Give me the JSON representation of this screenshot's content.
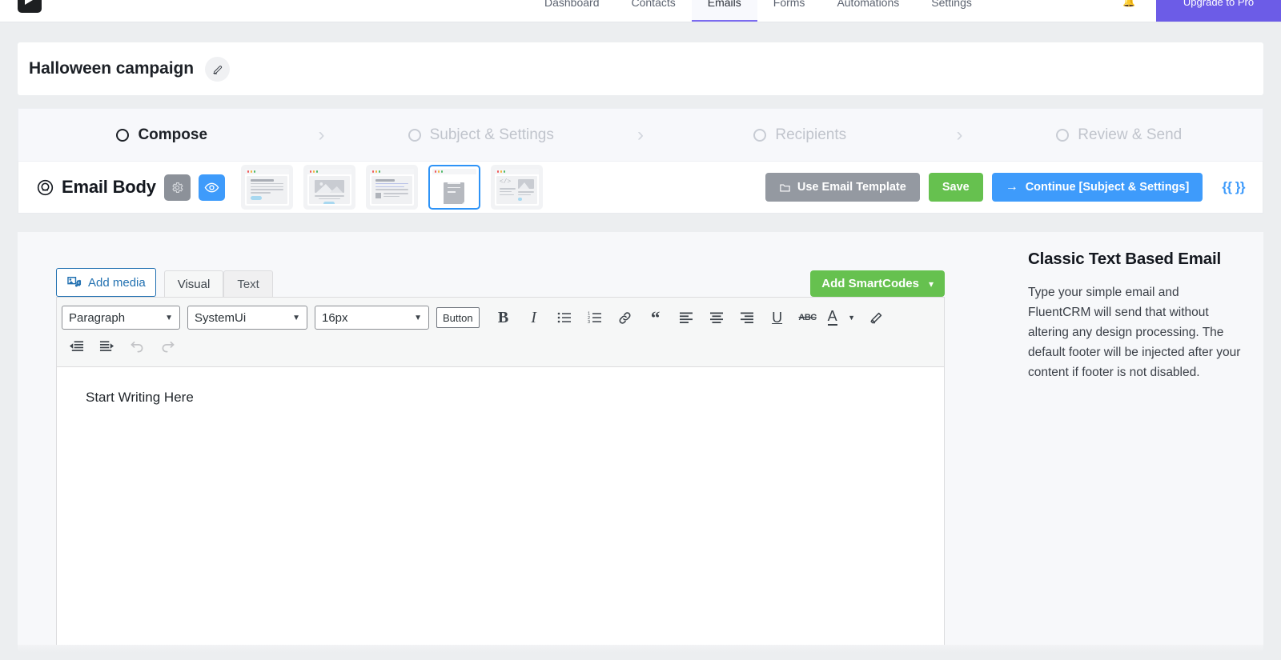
{
  "adminbar": {
    "logo_icon": "play-logo-icon",
    "tabs": [
      {
        "label": "Dashboard",
        "active": false
      },
      {
        "label": "Contacts",
        "active": false
      },
      {
        "label": "Emails",
        "active": true
      },
      {
        "label": "Forms",
        "active": false
      },
      {
        "label": "Automations",
        "active": false
      },
      {
        "label": "Settings",
        "active": false
      }
    ],
    "bell_icon": "bell-icon",
    "cta_label": "Upgrade to Pro"
  },
  "campaign": {
    "title": "Halloween campaign",
    "edit_icon": "pencil-edit-icon"
  },
  "stepper": {
    "separator": "›",
    "steps": [
      {
        "label": "Compose",
        "active": true
      },
      {
        "label": "Subject & Settings",
        "active": false
      },
      {
        "label": "Recipients",
        "active": false
      },
      {
        "label": "Review & Send",
        "active": false
      }
    ]
  },
  "body_bar": {
    "logo_icon": "target-circle-icon",
    "title": "Email Body",
    "settings_icon": "gear-icon",
    "preview_icon": "eye-icon",
    "templates": [
      {
        "name": "text-blocks-template",
        "selected": false
      },
      {
        "name": "image-template",
        "selected": false
      },
      {
        "name": "mixed-content-template",
        "selected": false
      },
      {
        "name": "classic-text-template",
        "selected": true
      },
      {
        "name": "raw-html-template",
        "selected": false
      }
    ],
    "use_template_label": "Use Email Template",
    "folder_icon": "folder-icon",
    "save_label": "Save",
    "continue_label": "Continue [Subject & Settings]",
    "arrow_icon": "arrow-right-icon",
    "smartcode_icon_label": "{{ }}"
  },
  "editor": {
    "add_media_label": "Add media",
    "add_media_icon": "media-photo-music-icon",
    "tabs": [
      {
        "label": "Visual",
        "active": true
      },
      {
        "label": "Text",
        "active": false
      }
    ],
    "smartcodes_label": "Add SmartCodes",
    "smartcodes_caret": "⌄",
    "toolbar": {
      "paragraph_value": "Paragraph",
      "font_value": "SystemUi",
      "size_value": "16px",
      "button_label": "Button",
      "caret": "▼",
      "icons": [
        {
          "name": "bold-icon",
          "glyph": "B"
        },
        {
          "name": "italic-icon",
          "glyph": "I"
        },
        {
          "name": "bullet-list-icon",
          "glyph": ""
        },
        {
          "name": "numbered-list-icon",
          "glyph": ""
        },
        {
          "name": "link-icon",
          "glyph": ""
        },
        {
          "name": "blockquote-icon",
          "glyph": "“"
        },
        {
          "name": "align-left-icon",
          "glyph": ""
        },
        {
          "name": "align-center-icon",
          "glyph": ""
        },
        {
          "name": "align-right-icon",
          "glyph": ""
        },
        {
          "name": "underline-icon",
          "glyph": "U"
        },
        {
          "name": "strikethrough-icon",
          "glyph": "ABC"
        },
        {
          "name": "text-color-icon",
          "glyph": "A"
        },
        {
          "name": "clear-formatting-icon",
          "glyph": ""
        }
      ],
      "row2_icons": [
        {
          "name": "outdent-icon"
        },
        {
          "name": "indent-icon"
        },
        {
          "name": "undo-icon"
        },
        {
          "name": "redo-icon"
        }
      ]
    },
    "content_placeholder": "Start Writing Here"
  },
  "info": {
    "title": "Classic Text Based Email",
    "description": "Type your simple email and FluentCRM will send that without altering any design processing. The default footer will be injected after your content if footer is not disabled."
  },
  "colors": {
    "brand_purple": "#6c5ce7",
    "accent_blue": "#3e9bfb",
    "success_green": "#66c14f",
    "neutral_grey": "#9499a1",
    "wp_blue": "#2271b1"
  }
}
